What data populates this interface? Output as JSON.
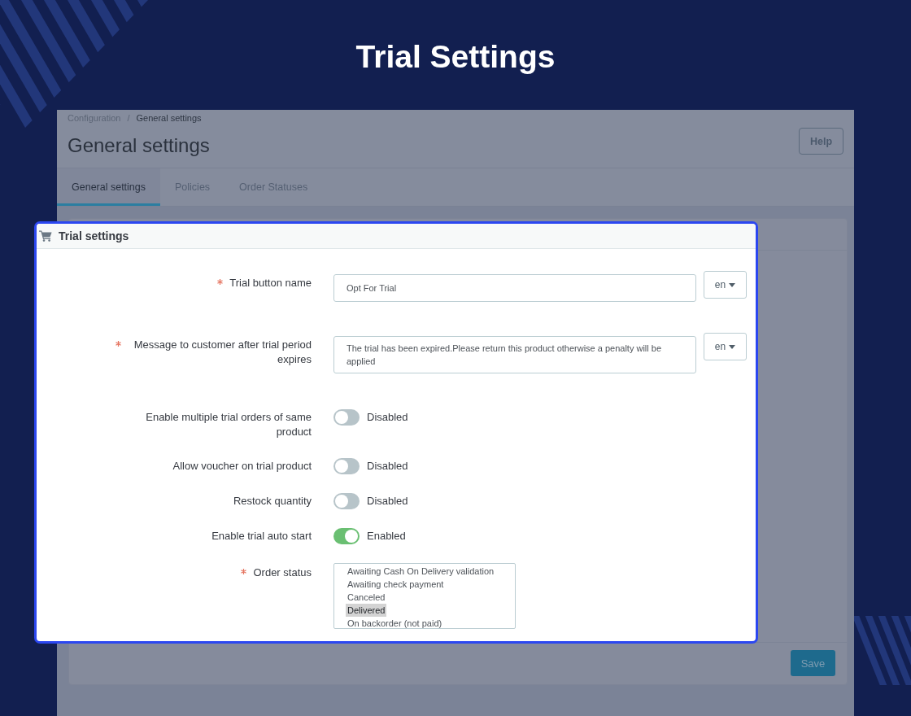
{
  "title": "Trial Settings",
  "screen": {
    "breadcrumb": [
      {
        "label": "Configuration"
      },
      {
        "label": "General settings"
      }
    ],
    "breadcrumb_separator": "/",
    "heading": "General settings",
    "help_button": "Help",
    "tabs": [
      {
        "label": "General settings",
        "selected": true
      },
      {
        "label": "Policies",
        "selected": false
      },
      {
        "label": "Order Statuses",
        "selected": false
      }
    ],
    "save_button": "Save"
  },
  "dialog": {
    "title": "Trial settings",
    "fields": [
      {
        "kind": "text",
        "label": "Trial button name",
        "required": true,
        "value": "Opt For Trial",
        "language": "en"
      },
      {
        "kind": "textarea",
        "label": "Message to customer after trial period expires",
        "required": true,
        "value": "The trial has been expired.Please return this product otherwise a penalty will be applied",
        "language": "en"
      },
      {
        "kind": "switch",
        "label": "Enable multiple trial orders of same product",
        "required": false,
        "on": false,
        "status": "Disabled"
      },
      {
        "kind": "switch",
        "label": "Allow voucher on trial product",
        "required": false,
        "on": false,
        "status": "Disabled"
      },
      {
        "kind": "switch",
        "label": "Restock quantity",
        "required": false,
        "on": false,
        "status": "Disabled"
      },
      {
        "kind": "switch",
        "label": "Enable trial auto start",
        "required": false,
        "on": true,
        "status": "Enabled"
      },
      {
        "kind": "listbox",
        "label": "Order status",
        "required": true,
        "options": [
          {
            "label": "Awaiting Cash On Delivery validation",
            "selected": false
          },
          {
            "label": "Awaiting check payment",
            "selected": false
          },
          {
            "label": "Canceled",
            "selected": false
          },
          {
            "label": "Delivered",
            "selected": true
          },
          {
            "label": "On backorder (not paid)",
            "selected": false
          }
        ]
      }
    ]
  }
}
